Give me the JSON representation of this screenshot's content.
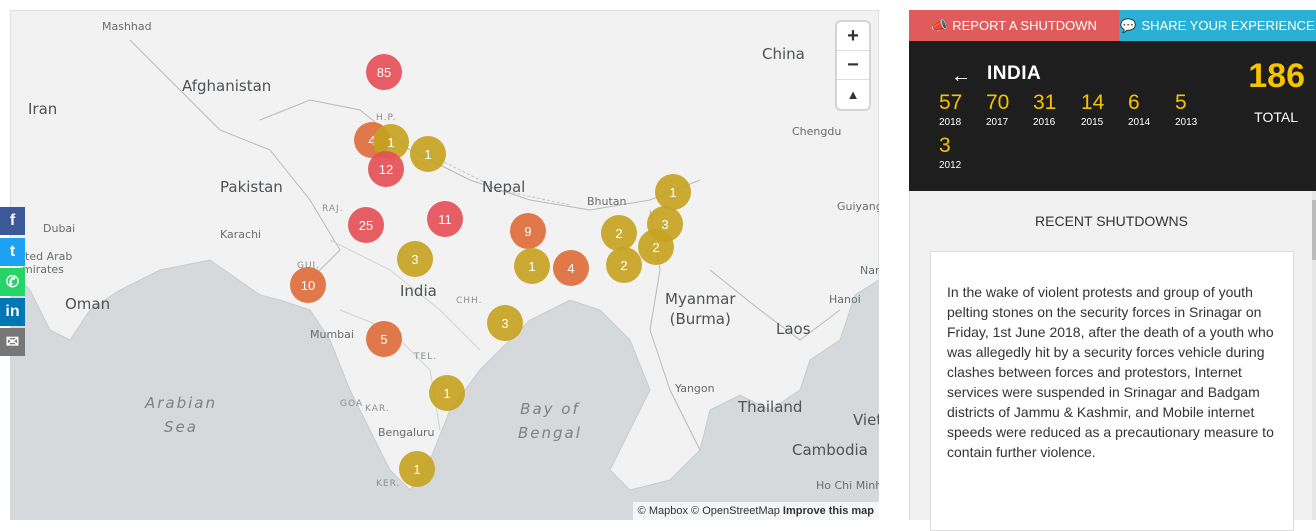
{
  "map": {
    "countries": [
      "Afghanistan",
      "Iran",
      "Pakistan",
      "India",
      "Nepal",
      "China",
      "Oman",
      "Myanmar\n(Burma)",
      "Laos",
      "Thailand",
      "Cambodia",
      "Viet",
      "Bhutan"
    ],
    "cities": [
      "Mashhad",
      "Karachi",
      "Dubai",
      "Mumbai",
      "Bengaluru",
      "Chengdu",
      "Guiyang",
      "Hanoi",
      "Yangon",
      "Ho Chi Minh",
      "Nar",
      "ited Arab\nmirates"
    ],
    "states": [
      "H.P.",
      "RAJ.",
      "GUJ.",
      "CHH.",
      "TEL.",
      "KAR.",
      "GOA",
      "KER."
    ],
    "seas": [
      "Arabian\nSea",
      "Bay of\nBengal"
    ],
    "clusters": [
      {
        "label": "85",
        "color": "red"
      },
      {
        "label": "4",
        "color": "orange"
      },
      {
        "label": "1",
        "color": "yellow"
      },
      {
        "label": "1",
        "color": "yellow"
      },
      {
        "label": "12",
        "color": "red"
      },
      {
        "label": "25",
        "color": "red"
      },
      {
        "label": "11",
        "color": "red"
      },
      {
        "label": "9",
        "color": "orange"
      },
      {
        "label": "3",
        "color": "yellow"
      },
      {
        "label": "10",
        "color": "orange"
      },
      {
        "label": "1",
        "color": "yellow"
      },
      {
        "label": "4",
        "color": "orange"
      },
      {
        "label": "2",
        "color": "yellow"
      },
      {
        "label": "2",
        "color": "yellow"
      },
      {
        "label": "3",
        "color": "yellow"
      },
      {
        "label": "2",
        "color": "yellow"
      },
      {
        "label": "1",
        "color": "yellow"
      },
      {
        "label": "5",
        "color": "orange"
      },
      {
        "label": "3",
        "color": "yellow"
      },
      {
        "label": "1",
        "color": "yellow"
      },
      {
        "label": "1",
        "color": "yellow"
      }
    ],
    "zoom_in": "+",
    "zoom_out": "−",
    "compass": "▲",
    "attribution_1": "© Mapbox",
    "attribution_2": "© OpenStreetMap",
    "attribution_3": "Improve this map"
  },
  "social": [
    {
      "icon": "facebook-icon",
      "glyph": "f",
      "color": "#3b5998"
    },
    {
      "icon": "twitter-icon",
      "glyph": "t",
      "color": "#1da1f2"
    },
    {
      "icon": "whatsapp-icon",
      "glyph": "✆",
      "color": "#25d366"
    },
    {
      "icon": "linkedin-icon",
      "glyph": "in",
      "color": "#0077b5"
    },
    {
      "icon": "email-icon",
      "glyph": "✉",
      "color": "#777777"
    }
  ],
  "panel": {
    "report_label": "REPORT A SHUTDOWN",
    "share_label": "SHARE YOUR EXPERIENCE",
    "country": "INDIA",
    "back": "←",
    "years": [
      {
        "count": "57",
        "year": "2018"
      },
      {
        "count": "70",
        "year": "2017"
      },
      {
        "count": "31",
        "year": "2016"
      },
      {
        "count": "14",
        "year": "2015"
      },
      {
        "count": "6",
        "year": "2014"
      },
      {
        "count": "5",
        "year": "2013"
      },
      {
        "count": "3",
        "year": "2012"
      }
    ],
    "total": "186",
    "total_label": "TOTAL",
    "recent_title": "RECENT SHUTDOWNS",
    "recent_text": "In the wake of violent protests and group of youth pelting stones on the security forces in Srinagar on Friday, 1st June 2018, after the death of a youth who was allegedly hit by a security forces vehicle during clashes between forces and protestors, Internet services were suspended in Srinagar and Badgam districts of Jammu & Kashmir, and Mobile internet speeds were reduced as a precautionary measure to contain further violence."
  },
  "colors": {
    "red": "#e55057",
    "orange": "#de6e3c",
    "yellow": "#c5a21e",
    "report": "#e05c5c",
    "share": "#2ab0d4",
    "accent": "#f5c400"
  }
}
